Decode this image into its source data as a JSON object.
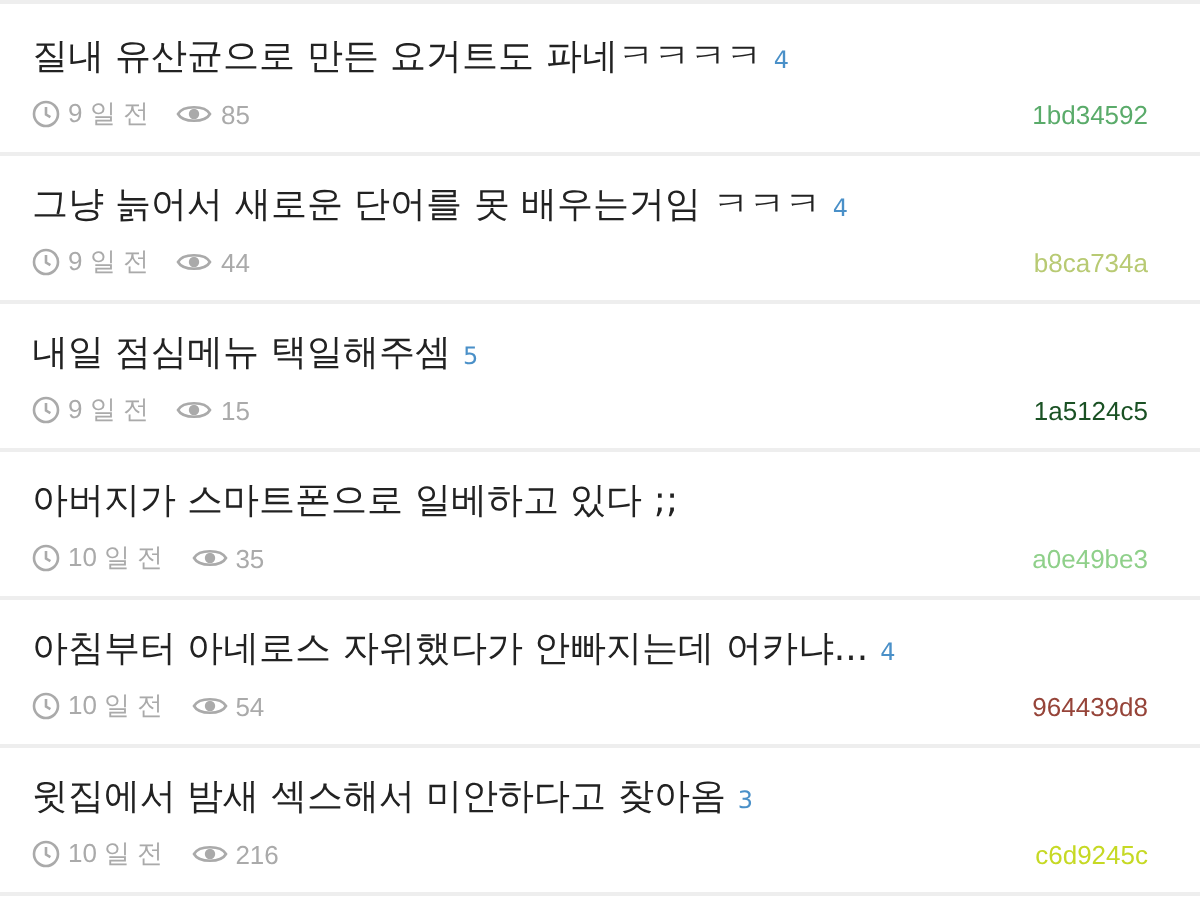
{
  "posts": [
    {
      "title": "질내 유산균으로 만든 요거트도 파네ㅋㅋㅋㅋ",
      "comments": "4",
      "time": "9 일 전",
      "views": "85",
      "author": "1bd34592",
      "color": "#5aab6a"
    },
    {
      "title": "그냥 늙어서 새로운 단어를 못 배우는거임 ㅋㅋㅋ",
      "comments": "4",
      "time": "9 일 전",
      "views": "44",
      "author": "b8ca734a",
      "color": "#b8ca73"
    },
    {
      "title": "내일 점심메뉴 택일해주셈",
      "comments": "5",
      "time": "9 일 전",
      "views": "15",
      "author": "1a5124c5",
      "color": "#1a5124"
    },
    {
      "title": "아버지가 스마트폰으로 일베하고 있다 ;;",
      "time": "10 일 전",
      "views": "35",
      "author": "a0e49be3",
      "color": "#8fd08a"
    },
    {
      "title": "아침부터 아네로스 자위했다가 안빠지는데 어카냐...",
      "comments": "4",
      "time": "10 일 전",
      "views": "54",
      "author": "964439d8",
      "color": "#964439"
    },
    {
      "title": "윗집에서 밤새 섹스해서 미안하다고 찾아옴",
      "comments": "3",
      "time": "10 일 전",
      "views": "216",
      "author": "c6d9245c",
      "color": "#c6d924"
    }
  ]
}
